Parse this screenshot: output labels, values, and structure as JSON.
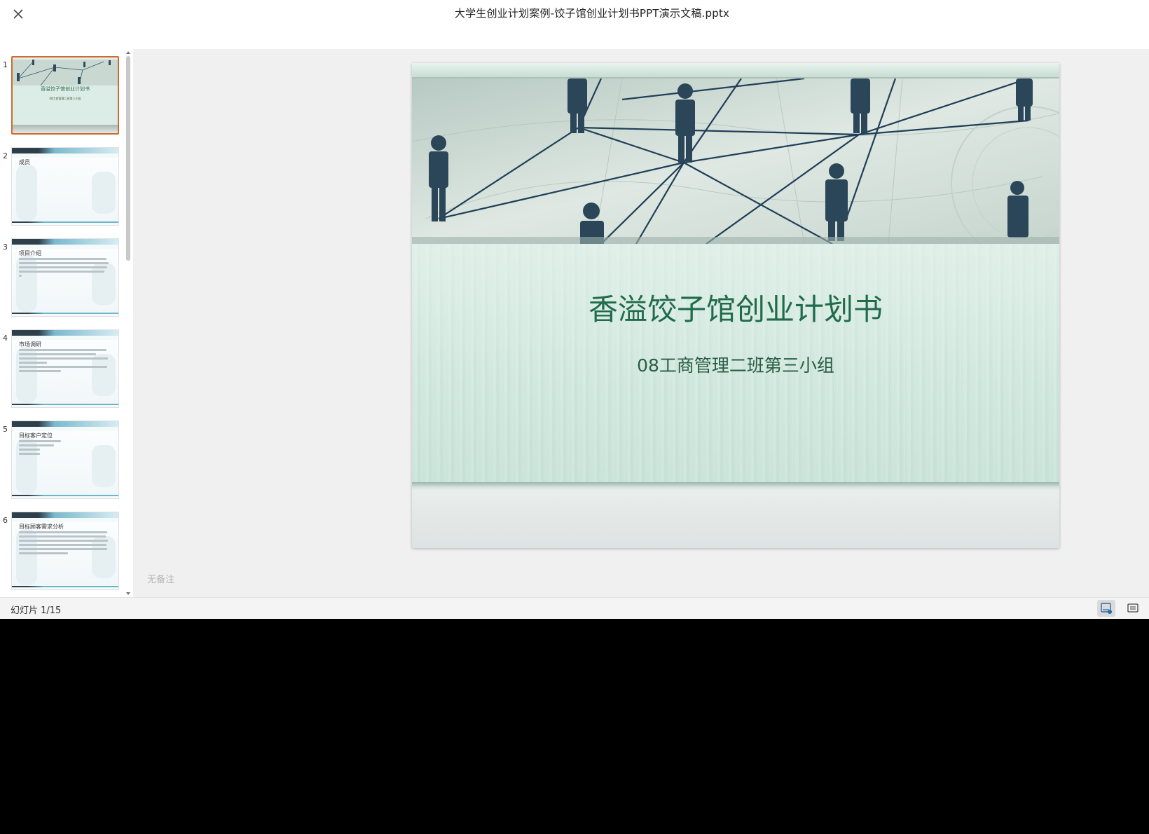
{
  "header": {
    "title": "大学生创业计划案例-饺子馆创业计划书PPT演示文稿.pptx",
    "close_icon": "close-icon"
  },
  "sidebar": {
    "thumbnails": [
      {
        "number": "1",
        "title": "香溢饺子馆创业计划书",
        "subtitle": "08工商管理二班第三小组",
        "active": true
      },
      {
        "number": "2",
        "title": "成员"
      },
      {
        "number": "3",
        "title": "项目介绍"
      },
      {
        "number": "4",
        "title": "市场调研"
      },
      {
        "number": "5",
        "title": "目标客户定位"
      },
      {
        "number": "6",
        "title": "目标顾客需求分析"
      }
    ]
  },
  "slide": {
    "title": "香溢饺子馆创业计划书",
    "subtitle": "08工商管理二班第三小组",
    "title_color": "#1f6b4a"
  },
  "notes": {
    "placeholder": "无备注"
  },
  "statusbar": {
    "counter": "幻灯片 1/15",
    "notes_icon": "notes-view-icon",
    "comment_icon": "comment-icon"
  },
  "colors": {
    "accent_active": "#d16a2c",
    "background_main": "#f0f0f0"
  }
}
